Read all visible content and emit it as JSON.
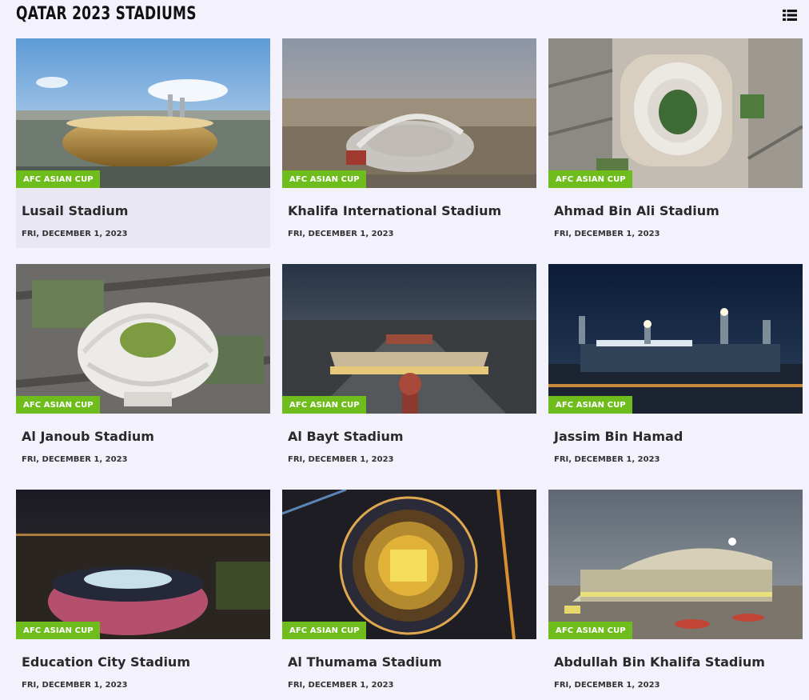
{
  "page": {
    "title": "QATAR 2023 STADIUMS",
    "view_toggle_icon": "list-view-icon"
  },
  "colors": {
    "background": "#f3f1fc",
    "badge": "#6fbd1d",
    "featured_card": "#e9e7f4"
  },
  "cards": [
    {
      "title": "Lusail Stadium",
      "badge": "AFC ASIAN CUP",
      "date": "FRI, DECEMBER 1, 2023",
      "image": "lusail-stadium-photo"
    },
    {
      "title": "Khalifa International Stadium",
      "badge": "AFC ASIAN CUP",
      "date": "FRI, DECEMBER 1, 2023",
      "image": "khalifa-stadium-photo"
    },
    {
      "title": "Ahmad Bin Ali Stadium",
      "badge": "AFC ASIAN CUP",
      "date": "FRI, DECEMBER 1, 2023",
      "image": "ahmad-bin-ali-stadium-photo"
    },
    {
      "title": "Al Janoub Stadium",
      "badge": "AFC ASIAN CUP",
      "date": "FRI, DECEMBER 1, 2023",
      "image": "al-janoub-stadium-photo"
    },
    {
      "title": "Al Bayt Stadium",
      "badge": "AFC ASIAN CUP",
      "date": "FRI, DECEMBER 1, 2023",
      "image": "al-bayt-stadium-photo"
    },
    {
      "title": "Jassim Bin Hamad",
      "badge": "AFC ASIAN CUP",
      "date": "FRI, DECEMBER 1, 2023",
      "image": "jassim-bin-hamad-stadium-photo"
    },
    {
      "title": "Education City Stadium",
      "badge": "AFC ASIAN CUP",
      "date": "FRI, DECEMBER 1, 2023",
      "image": "education-city-stadium-photo"
    },
    {
      "title": "Al Thumama Stadium",
      "badge": "AFC ASIAN CUP",
      "date": "FRI, DECEMBER 1, 2023",
      "image": "al-thumama-stadium-photo"
    },
    {
      "title": "Abdullah Bin Khalifa Stadium",
      "badge": "AFC ASIAN CUP",
      "date": "FRI, DECEMBER 1, 2023",
      "image": "abdullah-bin-khalifa-stadium-photo"
    }
  ]
}
